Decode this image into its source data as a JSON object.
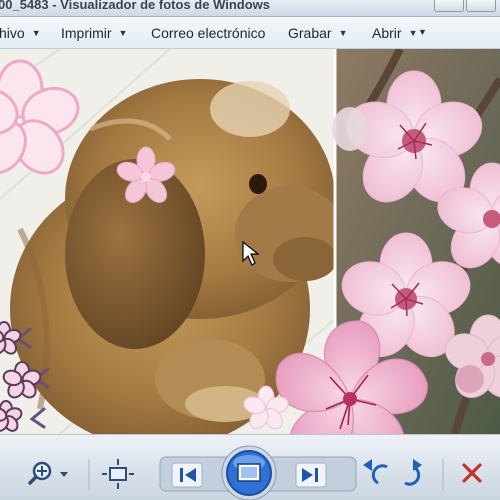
{
  "window": {
    "title": "00_5483 - Visualizador de fotos de Windows"
  },
  "menu": {
    "items": [
      {
        "label": "hivo"
      },
      {
        "label": "Imprimir"
      },
      {
        "label": "Correo electrónico"
      },
      {
        "label": "Grabar"
      },
      {
        "label": "Abrir"
      }
    ]
  },
  "photo": {
    "description_tags": [
      "puppy-photo",
      "cherry-blossom-photo",
      "flower-stickers"
    ]
  },
  "toolbar": {
    "buttons": [
      {
        "name": "zoom-button",
        "icon": "zoom-icon"
      },
      {
        "name": "actual-size-button",
        "icon": "fit-window-icon"
      },
      {
        "name": "previous-button",
        "icon": "previous-icon"
      },
      {
        "name": "slideshow-button",
        "icon": "slideshow-icon"
      },
      {
        "name": "next-button",
        "icon": "next-icon"
      },
      {
        "name": "rotate-counterclockwise-button",
        "icon": "rotate-left-icon"
      },
      {
        "name": "rotate-clockwise-button",
        "icon": "rotate-right-icon"
      },
      {
        "name": "delete-button",
        "icon": "delete-icon"
      }
    ]
  },
  "colors": {
    "accent": "#2f6fd6",
    "delete": "#c8312a",
    "blossom": "#f2b8cf"
  }
}
